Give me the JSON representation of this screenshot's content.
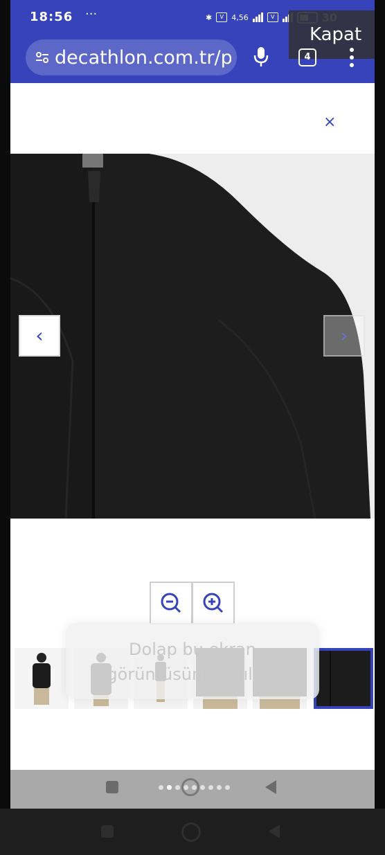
{
  "status_bar": {
    "time": "18:56",
    "more_indicator": "···",
    "network_badge": "4G",
    "speed": "4,56",
    "battery_level": "30"
  },
  "overlay": {
    "close_label": "Kapat"
  },
  "browser": {
    "url": "decathlon.com.tr/p",
    "tab_count": "4"
  },
  "page": {
    "close_glyph": "×",
    "prev_glyph": "‹",
    "next_glyph": "›"
  },
  "toast": {
    "line1": "Dolap bu ekran",
    "line2": "görüntüsünü algıladı"
  },
  "gallery": {
    "thumbnail_count": 6,
    "active_index": 5,
    "dots_total": 9,
    "dots_active": 1
  },
  "colors": {
    "brand_blue": "#3643ba",
    "jacket": "#1c1c1c"
  }
}
